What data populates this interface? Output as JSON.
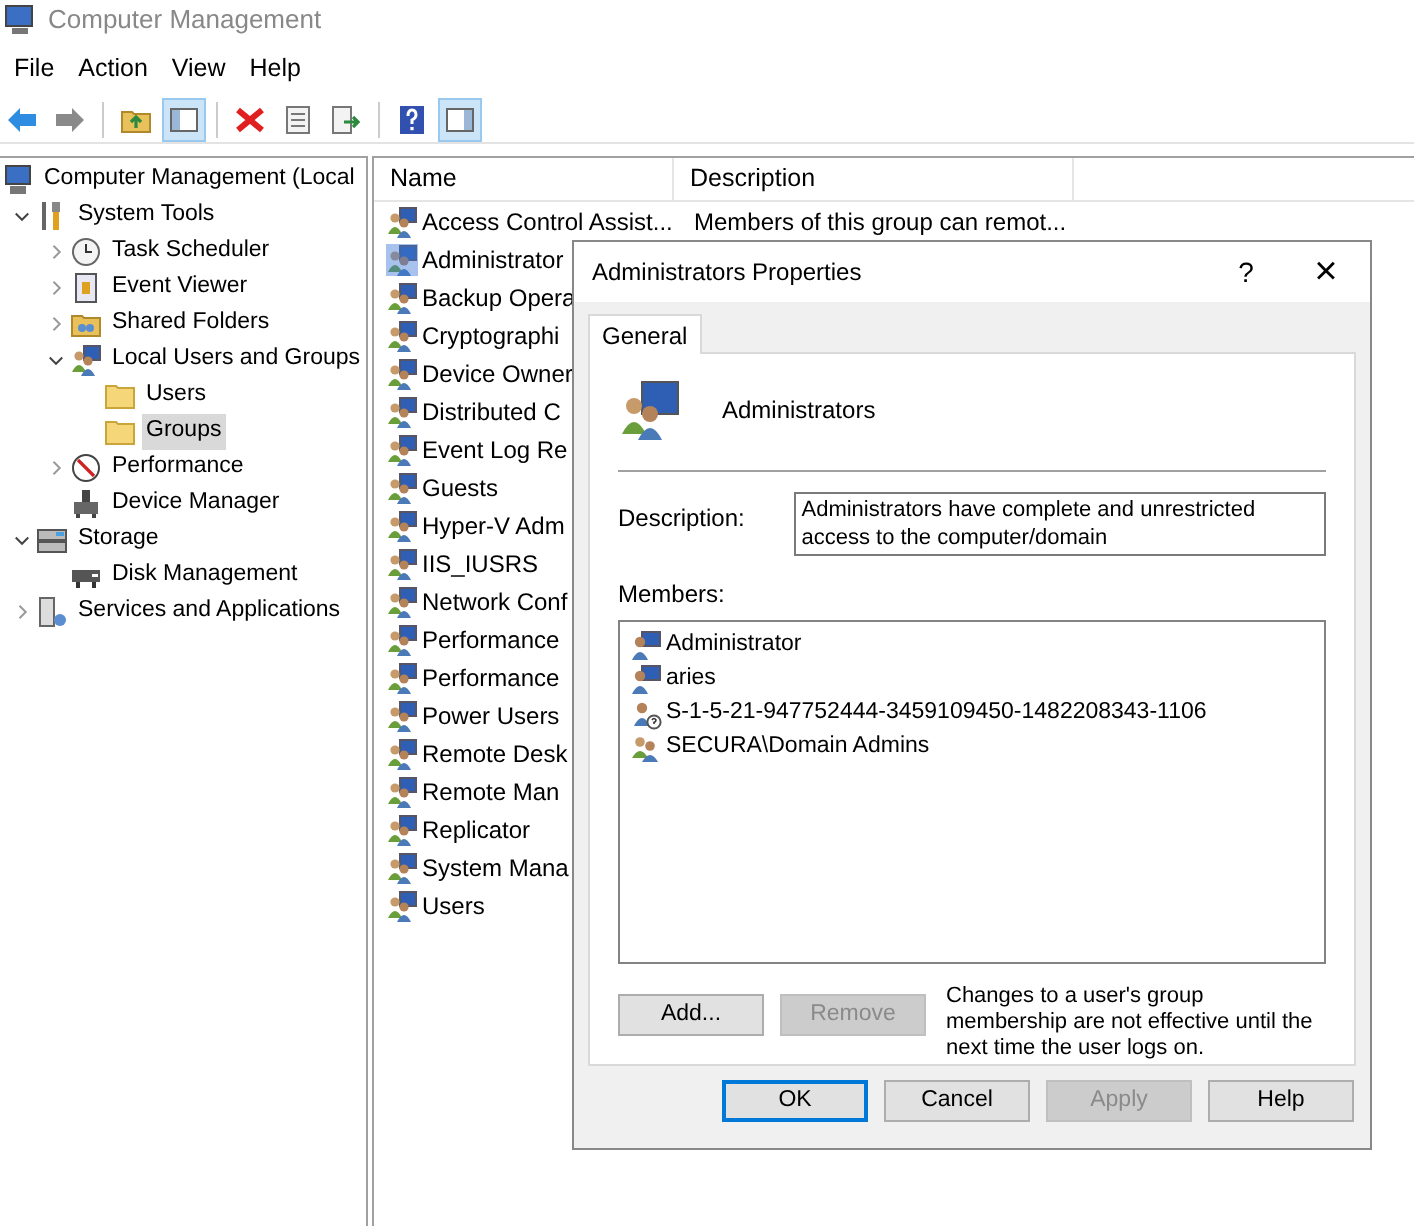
{
  "window": {
    "title": "Computer Management"
  },
  "menu": [
    "File",
    "Action",
    "View",
    "Help"
  ],
  "toolbar": [
    {
      "pressed": false
    },
    {
      "pressed": false
    },
    {
      "pressed": false
    },
    {
      "pressed": true
    },
    {
      "pressed": false
    },
    {
      "pressed": false
    },
    {
      "pressed": false
    },
    {
      "pressed": false
    },
    {
      "pressed": true
    }
  ],
  "tree": [
    {
      "label": "Computer Management (Local",
      "selected": false,
      "children": [
        {
          "label": "System Tools",
          "expanded": true,
          "selected": false,
          "children": [
            {
              "label": "Task Scheduler",
              "expanded": false,
              "selected": false
            },
            {
              "label": "Event Viewer",
              "expanded": false,
              "selected": false
            },
            {
              "label": "Shared Folders",
              "expanded": false,
              "selected": false
            },
            {
              "label": "Local Users and Groups",
              "expanded": true,
              "selected": false,
              "children": [
                {
                  "label": "Users",
                  "selected": false
                },
                {
                  "label": "Groups",
                  "selected": true
                }
              ]
            },
            {
              "label": "Performance",
              "expanded": false,
              "selected": false
            },
            {
              "label": "Device Manager",
              "selected": false
            }
          ]
        },
        {
          "label": "Storage",
          "expanded": true,
          "selected": false,
          "children": [
            {
              "label": "Disk Management",
              "selected": false
            }
          ]
        },
        {
          "label": "Services and Applications",
          "expanded": false,
          "selected": false
        }
      ]
    }
  ],
  "table": {
    "columns": [
      "Name",
      "Description"
    ],
    "rows": [
      {
        "name": "Access Control Assist...",
        "description": "Members of this group can remot...",
        "selected": false
      },
      {
        "name": "Administrator",
        "selected": true
      },
      {
        "name": "Backup Opera",
        "selected": false
      },
      {
        "name": "Cryptographi",
        "selected": false
      },
      {
        "name": "Device Owner",
        "selected": false
      },
      {
        "name": "Distributed C",
        "selected": false
      },
      {
        "name": "Event Log Re",
        "selected": false
      },
      {
        "name": "Guests",
        "selected": false
      },
      {
        "name": "Hyper-V Adm",
        "selected": false
      },
      {
        "name": "IIS_IUSRS",
        "selected": false
      },
      {
        "name": "Network Conf",
        "selected": false
      },
      {
        "name": "Performance",
        "selected": false
      },
      {
        "name": "Performance",
        "selected": false
      },
      {
        "name": "Power Users",
        "selected": false
      },
      {
        "name": "Remote Desk",
        "selected": false
      },
      {
        "name": "Remote Man",
        "selected": false
      },
      {
        "name": "Replicator",
        "selected": false
      },
      {
        "name": "System Mana",
        "selected": false
      },
      {
        "name": "Users",
        "selected": false
      }
    ]
  },
  "dialog": {
    "title": "Administrators Properties",
    "help": "?",
    "close": "×",
    "tabs": [
      {
        "label": "General",
        "selected": true
      }
    ],
    "group_name": "Administrators",
    "description_label": "Description:",
    "description": "Administrators have complete and unrestricted access to the computer/domain",
    "members_label": "Members:",
    "members": [
      {
        "name": "Administrator",
        "kind": "user"
      },
      {
        "name": "aries",
        "kind": "user"
      },
      {
        "name": "S-1-5-21-947752444-3459109450-1482208343-1106",
        "kind": "unknown"
      },
      {
        "name": "SECURA\\Domain Admins",
        "kind": "group"
      }
    ],
    "member_buttons": [
      {
        "label": "Add...",
        "disabled": false
      },
      {
        "label": "Remove",
        "disabled": true
      }
    ],
    "note": "Changes to a user's group membership are not effective until the next time the user logs on.",
    "buttons": [
      {
        "label": "OK",
        "default": true,
        "disabled": false
      },
      {
        "label": "Cancel",
        "default": false,
        "disabled": false
      },
      {
        "label": "Apply",
        "default": false,
        "disabled": true
      },
      {
        "label": "Help",
        "default": false,
        "disabled": false
      }
    ]
  }
}
